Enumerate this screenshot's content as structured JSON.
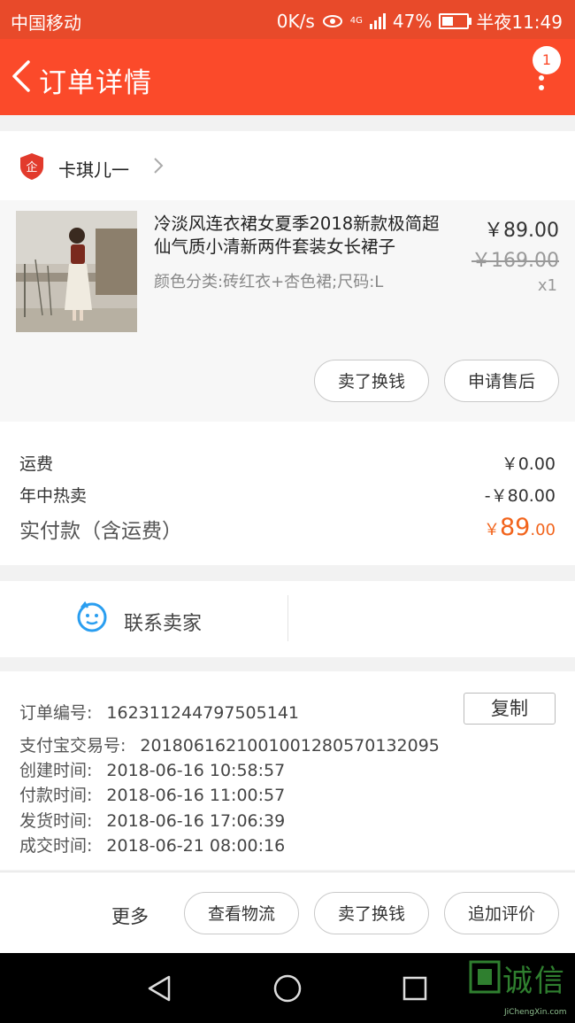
{
  "status_bar": {
    "carrier": "中国移动",
    "speed": "0K/s",
    "network": "4G",
    "battery_percent_text": "47%",
    "battery_level": 0.47,
    "time": "半夜11:49"
  },
  "header": {
    "title": "订单详情",
    "badge_count": "1"
  },
  "shop": {
    "name": "卡琪儿一",
    "icon_text": "企"
  },
  "item": {
    "title": "冷淡风连衣裙女夏季2018新款极简超仙气质小清新两件套装女长裙子",
    "spec": "颜色分类:砖红衣+杏色裙;尺码:L",
    "price": "￥89.00",
    "original_price": "￥169.00",
    "quantity": "x1",
    "actions": [
      "卖了换钱",
      "申请售后"
    ]
  },
  "fees": {
    "shipping_label": "运费",
    "shipping_value": "￥0.00",
    "discount_label": "年中热卖",
    "discount_value": "-￥80.00",
    "total_label": "实付款（含运费）",
    "total_currency": "￥",
    "total_int": "89",
    "total_dec": ".00"
  },
  "contact": {
    "label": "联系卖家"
  },
  "order_info": {
    "copy_label": "复制",
    "rows": [
      {
        "k": "订单编号:",
        "v": "162311244797505141"
      },
      {
        "k": "支付宝交易号:",
        "v": "2018061621001001280570132095"
      },
      {
        "k": "创建时间:",
        "v": "2018-06-16 10:58:57"
      },
      {
        "k": "付款时间:",
        "v": "2018-06-16 11:00:57"
      },
      {
        "k": "发货时间:",
        "v": "2018-06-16 17:06:39"
      },
      {
        "k": "成交时间:",
        "v": "2018-06-21 08:00:16"
      }
    ]
  },
  "bottom_bar": {
    "more": "更多",
    "buttons": [
      "查看物流",
      "卖了换钱",
      "追加评价"
    ]
  },
  "watermark": {
    "text": "诚信",
    "url": "JiChengXin.com"
  },
  "colors": {
    "header_bg": "#fb4a2a",
    "accent_orange": "#f2641c",
    "contact_blue": "#2a9ef0"
  }
}
